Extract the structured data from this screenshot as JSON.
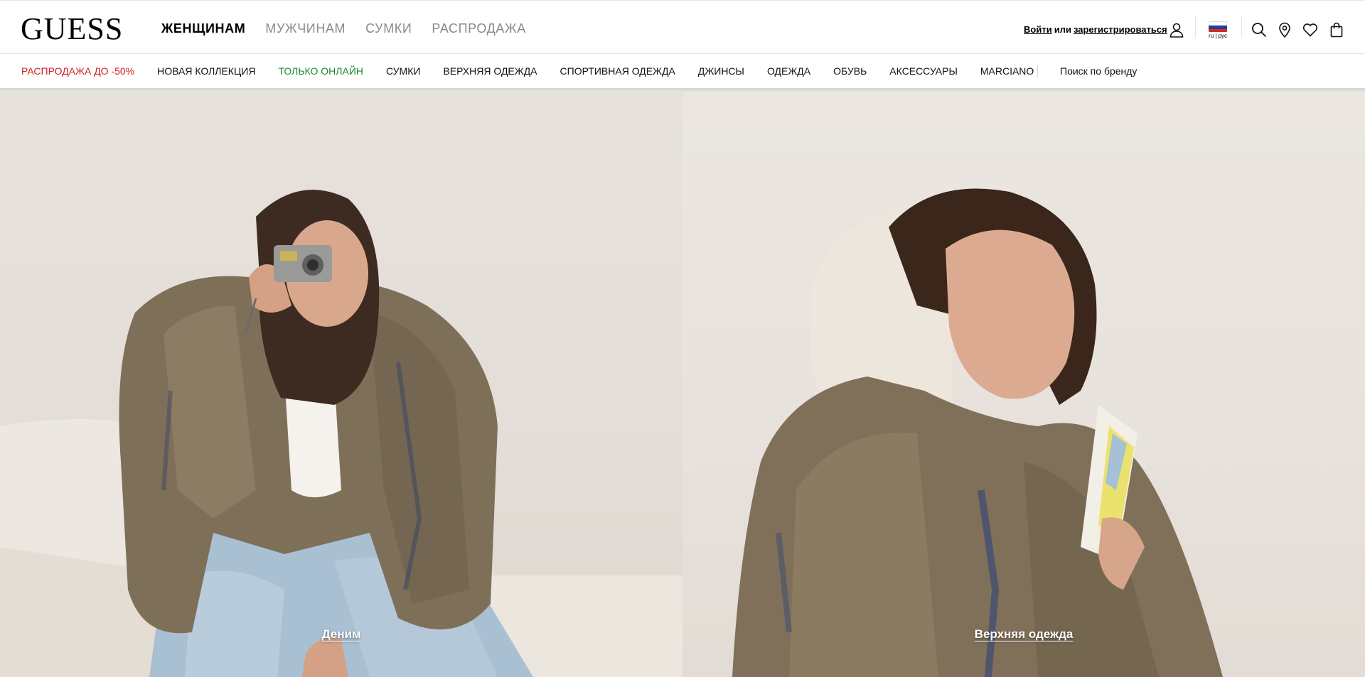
{
  "brand": {
    "logo": "GUESS"
  },
  "main_nav": [
    {
      "label": "ЖЕНЩИНАМ",
      "active": true
    },
    {
      "label": "МУЖЧИНАМ",
      "active": false
    },
    {
      "label": "СУМКИ",
      "active": false
    },
    {
      "label": "РАСПРОДАЖА",
      "active": false
    }
  ],
  "account": {
    "login": "Войти",
    "or": "или",
    "register": "зарегистрироваться"
  },
  "language": {
    "code": "ru | рус"
  },
  "icons": {
    "account": "user-icon",
    "search": "search-icon",
    "store": "location-pin-icon",
    "wishlist": "heart-icon",
    "cart": "shopping-bag-icon"
  },
  "category_nav": [
    {
      "label": "РАСПРОДАЖА ДО -50%"
    },
    {
      "label": "НОВАЯ КОЛЛЕКЦИЯ"
    },
    {
      "label": "ТОЛЬКО ОНЛАЙН"
    },
    {
      "label": "СУМКИ"
    },
    {
      "label": "ВЕРХНЯЯ ОДЕЖДА"
    },
    {
      "label": "СПОРТИВНАЯ ОДЕЖДА"
    },
    {
      "label": "ДЖИНСЫ"
    },
    {
      "label": "ОДЕЖДА"
    },
    {
      "label": "ОБУВЬ"
    },
    {
      "label": "АКСЕССУАРЫ"
    },
    {
      "label": "MARCIANO"
    }
  ],
  "brand_search": "Поиск по бренду",
  "hero": [
    {
      "caption": "Деним"
    },
    {
      "caption": "Верхняя одежда"
    }
  ],
  "colors": {
    "sale": "#d11f1f",
    "online": "#1a8a2e",
    "inactive_nav": "#8a8a8a"
  }
}
